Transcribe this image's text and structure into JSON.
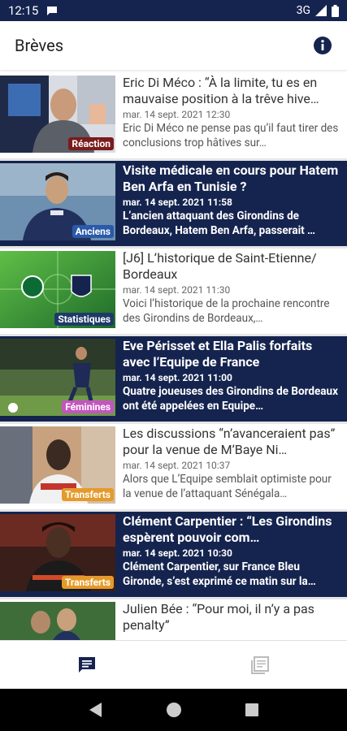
{
  "status_bar": {
    "time": "12:15",
    "network": "3G"
  },
  "app_bar": {
    "title": "Brèves"
  },
  "articles": [
    {
      "title": "Eric Di Méco : “À la limite, tu es en mauvaise position à la trêve hive…",
      "date": "mar. 14 sept. 2021 12:30",
      "desc": "Eric Di Méco ne pense pas qu’il faut tirer des conclusions trop hâtives sur…",
      "badge": "Réaction",
      "badge_color": "#7a1c1c",
      "highlighted": false
    },
    {
      "title": "Visite médicale en cours pour Hatem Ben Arfa en Tunisie ?",
      "date": "mar. 14 sept. 2021 11:58",
      "desc": "L’ancien attaquant des Girondins de Bordeaux, Hatem Ben Arfa, passerait …",
      "badge": "Anciens",
      "badge_color": "#2a5aa8",
      "highlighted": true
    },
    {
      "title": "[J6] L’historique de Saint-Etienne/ Bordeaux",
      "date": "mar. 14 sept. 2021 11:30",
      "desc": "Voici l’historique de la prochaine rencontre des Girondins de Bordeaux,…",
      "badge": "Statistiques",
      "badge_color": "#1f3a68",
      "highlighted": false
    },
    {
      "title": "Eve Périsset et Ella Palis forfaits avec l’Equipe de France",
      "date": "mar. 14 sept. 2021 11:00",
      "desc": "Quatre joueuses des Girondins de Bordeaux ont été appelées en Equipe…",
      "badge": "Féminines",
      "badge_color": "#c455c0",
      "highlighted": true
    },
    {
      "title": "Les discussions “n’avanceraient pas” pour la venue de M’Baye Ni…",
      "date": "mar. 14 sept. 2021 10:37",
      "desc": "Alors que L’Equipe semblait optimiste pour la venue de l’attaquant Sénégala…",
      "badge": "Transferts",
      "badge_color": "#e59a2a",
      "highlighted": false
    },
    {
      "title": "Clément Carpentier : “Les Girondins espèrent pouvoir com…",
      "date": "mar. 14 sept. 2021 10:30",
      "desc": "Clément Carpentier, sur France Bleu Gironde, s’est exprimé ce matin sur la…",
      "badge": "Transferts",
      "badge_color": "#e59a2a",
      "highlighted": true
    },
    {
      "title": "Julien Bée : “Pour moi, il n’y a pas penalty”",
      "date": "",
      "desc": "",
      "badge": "",
      "badge_color": "#000000",
      "highlighted": false
    }
  ],
  "bottom_nav": [
    {
      "icon": "chat-icon",
      "active": true
    },
    {
      "icon": "newspaper-icon",
      "active": false
    }
  ],
  "colors": {
    "primary": "#15244f",
    "separator": "#e6e6e6"
  }
}
